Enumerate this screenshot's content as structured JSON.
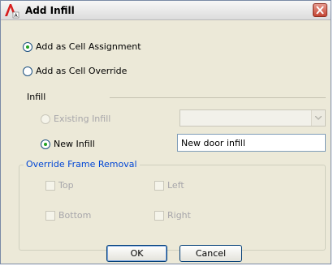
{
  "window": {
    "title": "Add Infill"
  },
  "options": {
    "cell_assignment": "Add as Cell Assignment",
    "cell_override": "Add as Cell Override"
  },
  "infill": {
    "section_label": "Infill",
    "existing_label": "Existing Infill",
    "existing_value": "",
    "new_label": "New Infill",
    "new_value": "New door infill"
  },
  "frame_removal": {
    "group_title": "Override Frame Removal",
    "top": "Top",
    "left": "Left",
    "bottom": "Bottom",
    "right": "Right"
  },
  "buttons": {
    "ok": "OK",
    "cancel": "Cancel"
  },
  "colors": {
    "accent_green": "#21a121",
    "group_title_blue": "#0046d5",
    "app_icon_red": "#d81e1e"
  }
}
